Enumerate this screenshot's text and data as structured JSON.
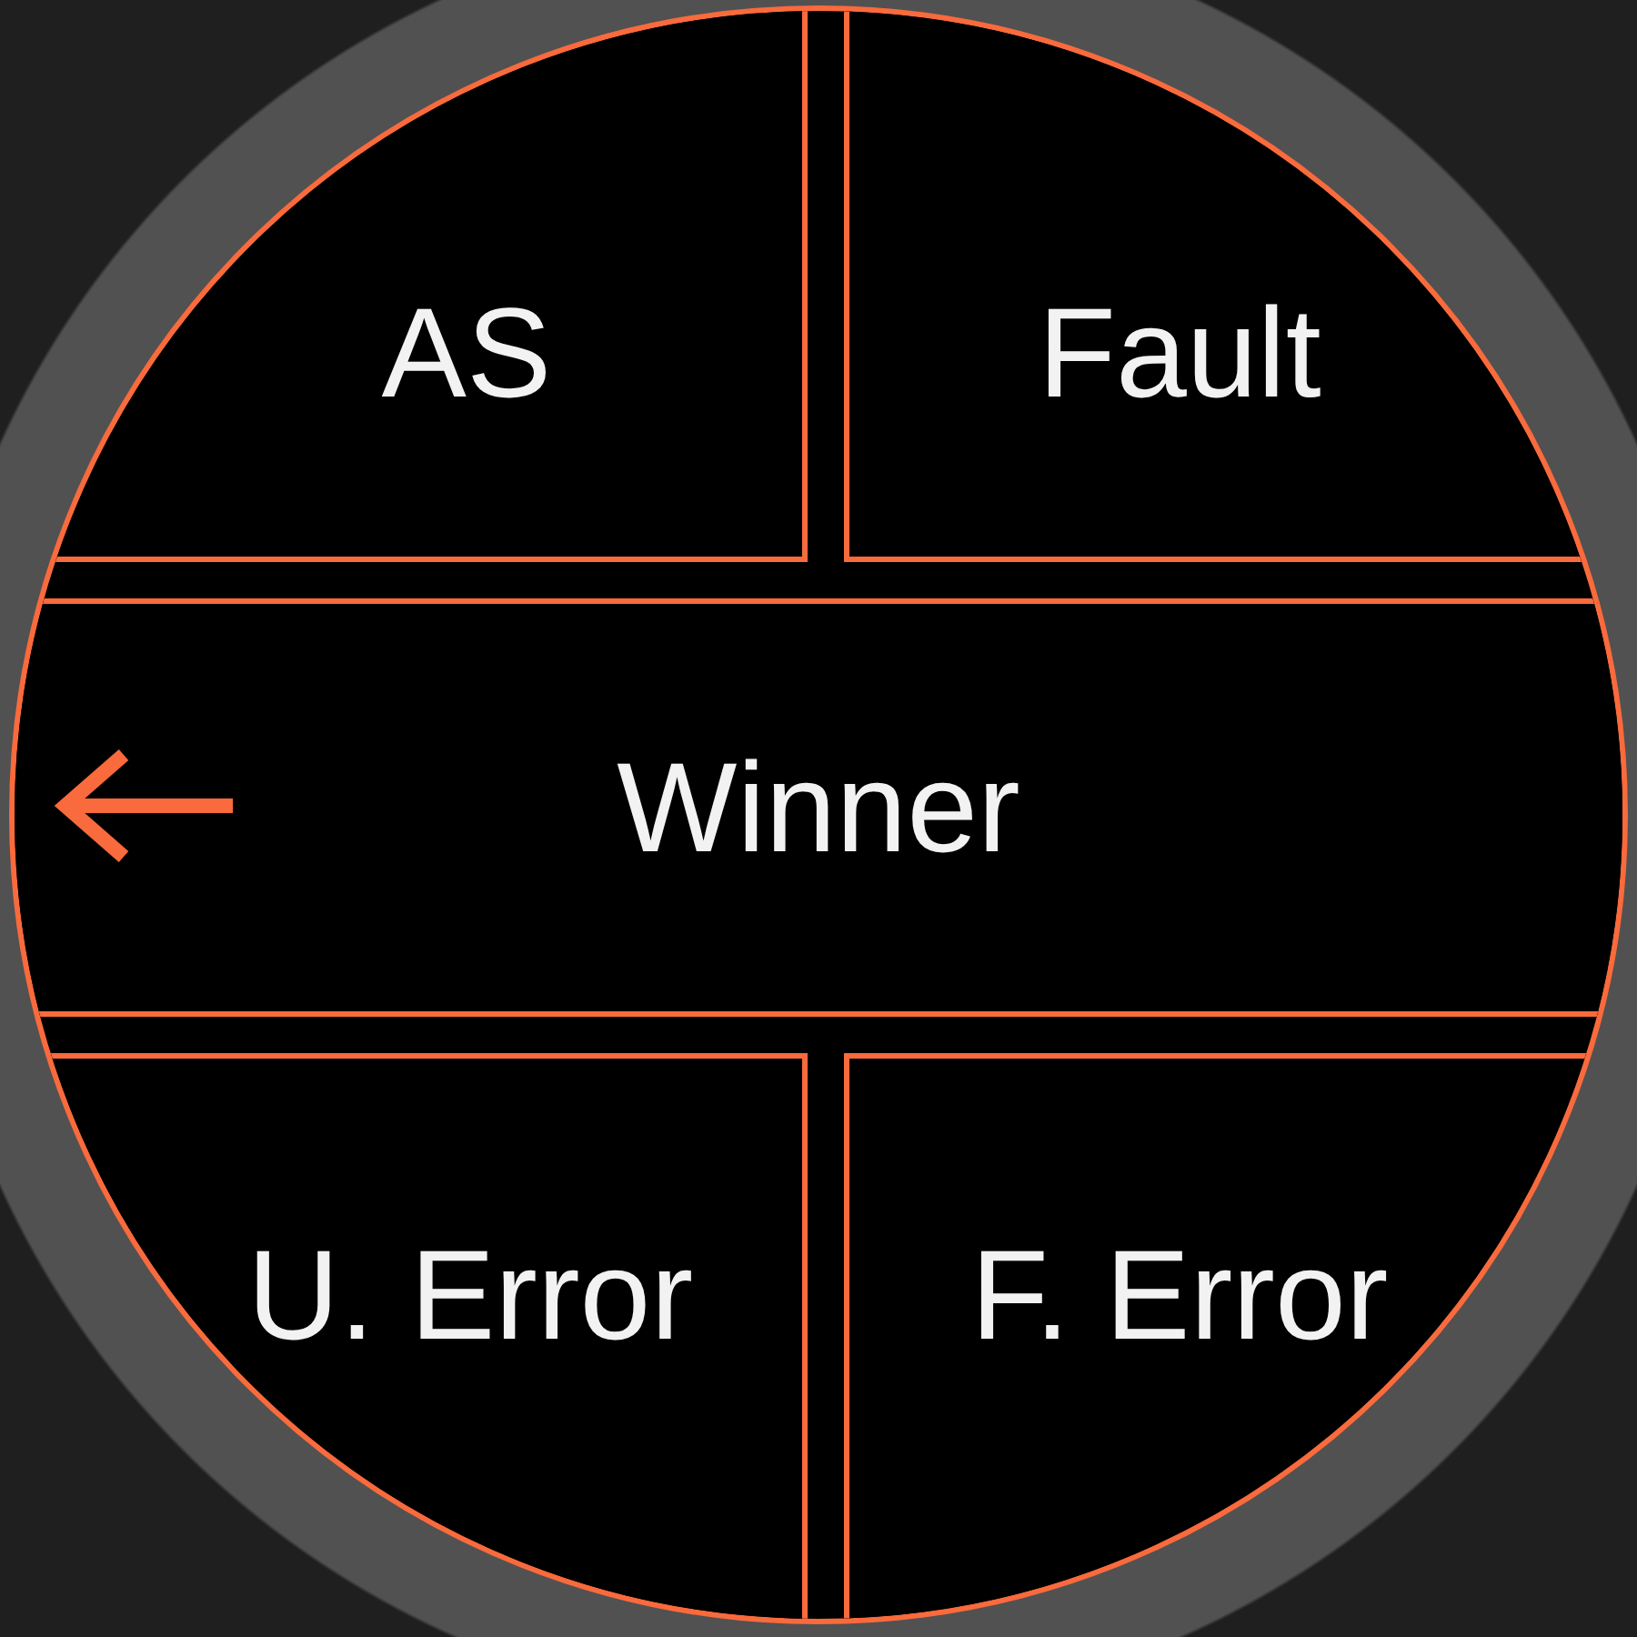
{
  "rows": [
    {
      "buttons": [
        {
          "label": "AS"
        },
        {
          "label": "Fault"
        }
      ]
    },
    {
      "buttons": [
        {
          "label": "Winner"
        }
      ]
    },
    {
      "buttons": [
        {
          "label": "U. Error"
        },
        {
          "label": "F. Error"
        }
      ]
    }
  ]
}
